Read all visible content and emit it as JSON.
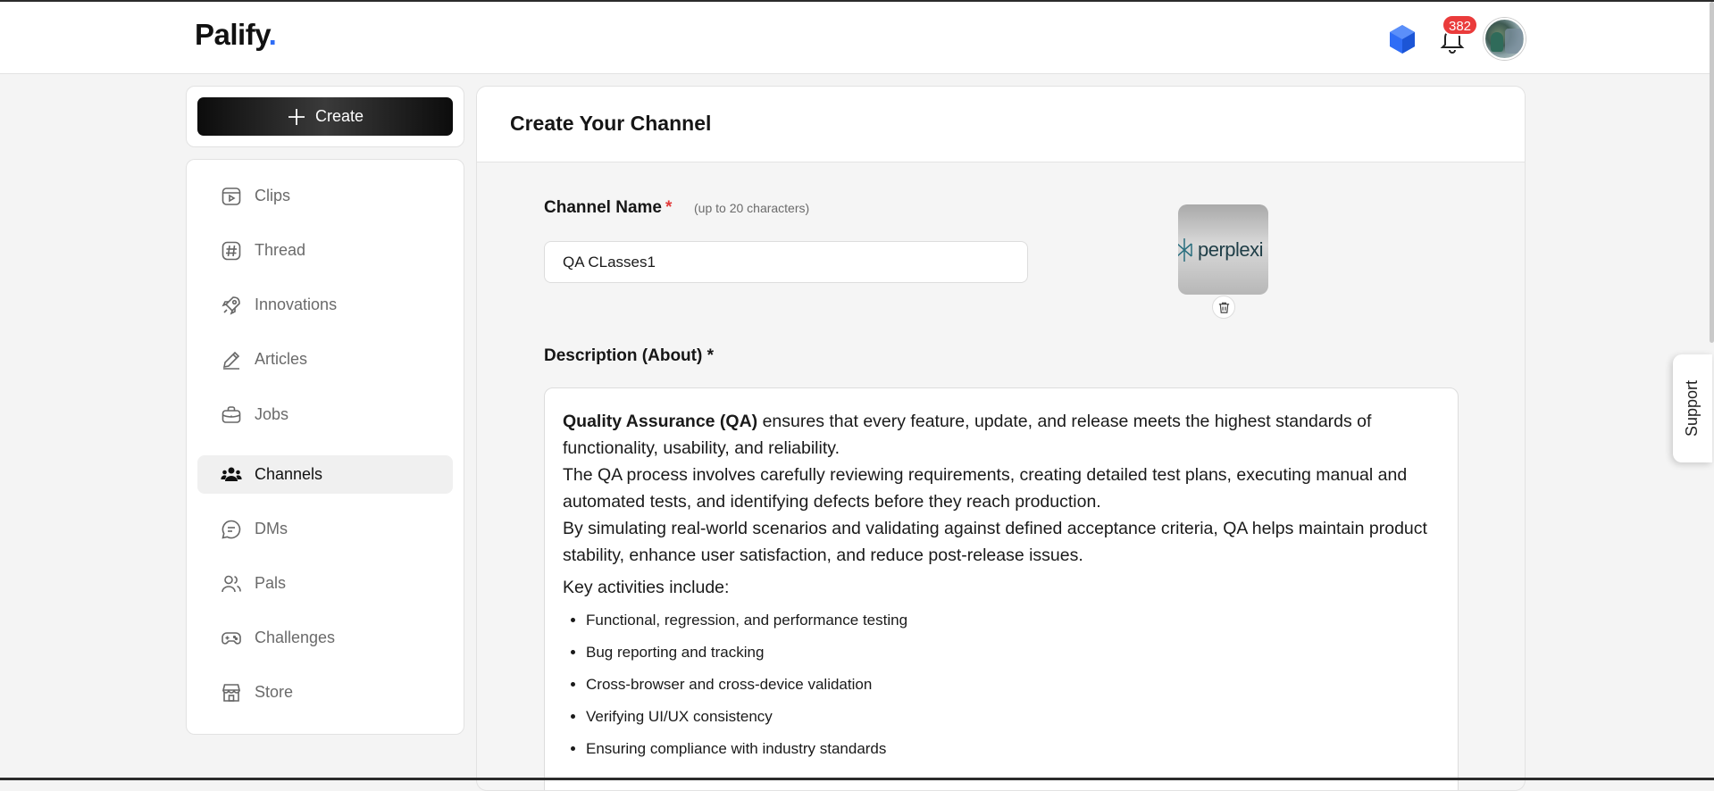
{
  "header": {
    "logo_text": "Palify",
    "logo_dot": ".",
    "notification_count": "382",
    "icons": [
      "cube-icon",
      "bell-icon",
      "avatar"
    ]
  },
  "create_button": {
    "label": "Create",
    "icon": "plus-icon"
  },
  "sidebar": {
    "items": [
      {
        "label": "Clips",
        "icon": "clips-icon",
        "active": false
      },
      {
        "label": "Thread",
        "icon": "hashtag-icon",
        "active": false
      },
      {
        "label": "Innovations",
        "icon": "rocket-icon",
        "active": false
      },
      {
        "label": "Articles",
        "icon": "pen-icon",
        "active": false
      },
      {
        "label": "Jobs",
        "icon": "briefcase-icon",
        "active": false
      },
      {
        "label": "Channels",
        "icon": "people-icon",
        "active": true
      },
      {
        "label": "DMs",
        "icon": "chat-icon",
        "active": false
      },
      {
        "label": "Pals",
        "icon": "users-icon",
        "active": false
      },
      {
        "label": "Challenges",
        "icon": "gamepad-icon",
        "active": false
      },
      {
        "label": "Store",
        "icon": "store-icon",
        "active": false
      }
    ]
  },
  "main": {
    "title": "Create Your Channel",
    "channel_name": {
      "label": "Channel Name",
      "required_mark": "*",
      "hint": "(up to 20 characters)",
      "value": "QA CLasses1"
    },
    "channel_image": {
      "text": "perplexi",
      "delete_icon": "trash-icon"
    },
    "description": {
      "label": "Description (About) *",
      "bold_lead": "Quality Assurance (QA)",
      "line1_rest": " ensures that every feature, update, and release meets the highest standards of functionality, usability, and reliability.",
      "line2": "The QA process involves carefully reviewing requirements, creating detailed test plans, executing manual and automated tests, and identifying defects before they reach production.",
      "line3": "By simulating real-world scenarios and validating against defined acceptance criteria, QA helps maintain product stability, enhance user satisfaction, and reduce post-release issues.",
      "key_activities": "Key activities include:",
      "bullets": [
        "Functional, regression, and performance testing",
        "Bug reporting and tracking",
        "Cross-browser and cross-device validation",
        "Verifying UI/UX consistency",
        "Ensuring compliance with industry standards"
      ]
    }
  },
  "support_tab": {
    "label": "Support"
  },
  "colors": {
    "accent": "#2f6df6",
    "badge": "#ea3b3b",
    "required": "#e23b3b"
  }
}
